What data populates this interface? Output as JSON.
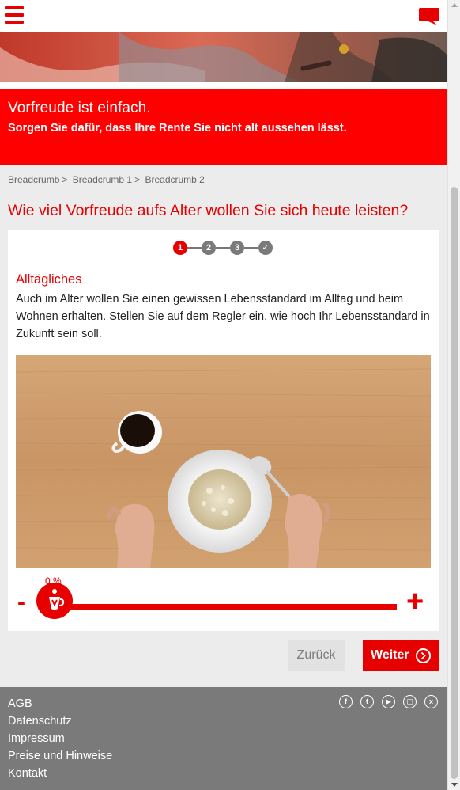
{
  "header": {
    "menu_icon": "hamburger-icon",
    "chat_icon": "speech-bubble-icon",
    "accent_color": "#e60000"
  },
  "banner": {
    "title": "Vorfreude ist einfach.",
    "subtitle": "Sorgen Sie dafür, dass Ihre Rente Sie nicht alt aussehen lässt."
  },
  "breadcrumb": {
    "items": [
      "Breadcrumb",
      "Breadcrumb 1",
      "Breadcrumb 2"
    ],
    "separator": ">"
  },
  "page": {
    "title": "Wie viel Vorfreude aufs Alter wollen Sie sich heute leisten?"
  },
  "steps": {
    "items": [
      "1",
      "2",
      "3",
      "✓"
    ],
    "active_index": 0
  },
  "section": {
    "title": "Alltägliches",
    "text": "Auch im Alter wollen Sie einen gewissen Lebensstandard im Alltag und beim Wohnen erhalten. Stellen Sie auf dem Regler ein, wie hoch Ihr Lebensstandard in Zukunft sein soll."
  },
  "slider": {
    "value_label": "0 %",
    "value": 0,
    "minus_label": "-",
    "plus_label": "+"
  },
  "buttons": {
    "back_label": "Zurück",
    "next_label": "Weiter"
  },
  "footer": {
    "links": [
      "AGB",
      "Datenschutz",
      "Impressum",
      "Preise und Hinweise",
      "Kontakt"
    ],
    "social_icons": [
      "facebook-icon",
      "twitter-icon",
      "youtube-icon",
      "instagram-icon",
      "xing-icon"
    ]
  }
}
